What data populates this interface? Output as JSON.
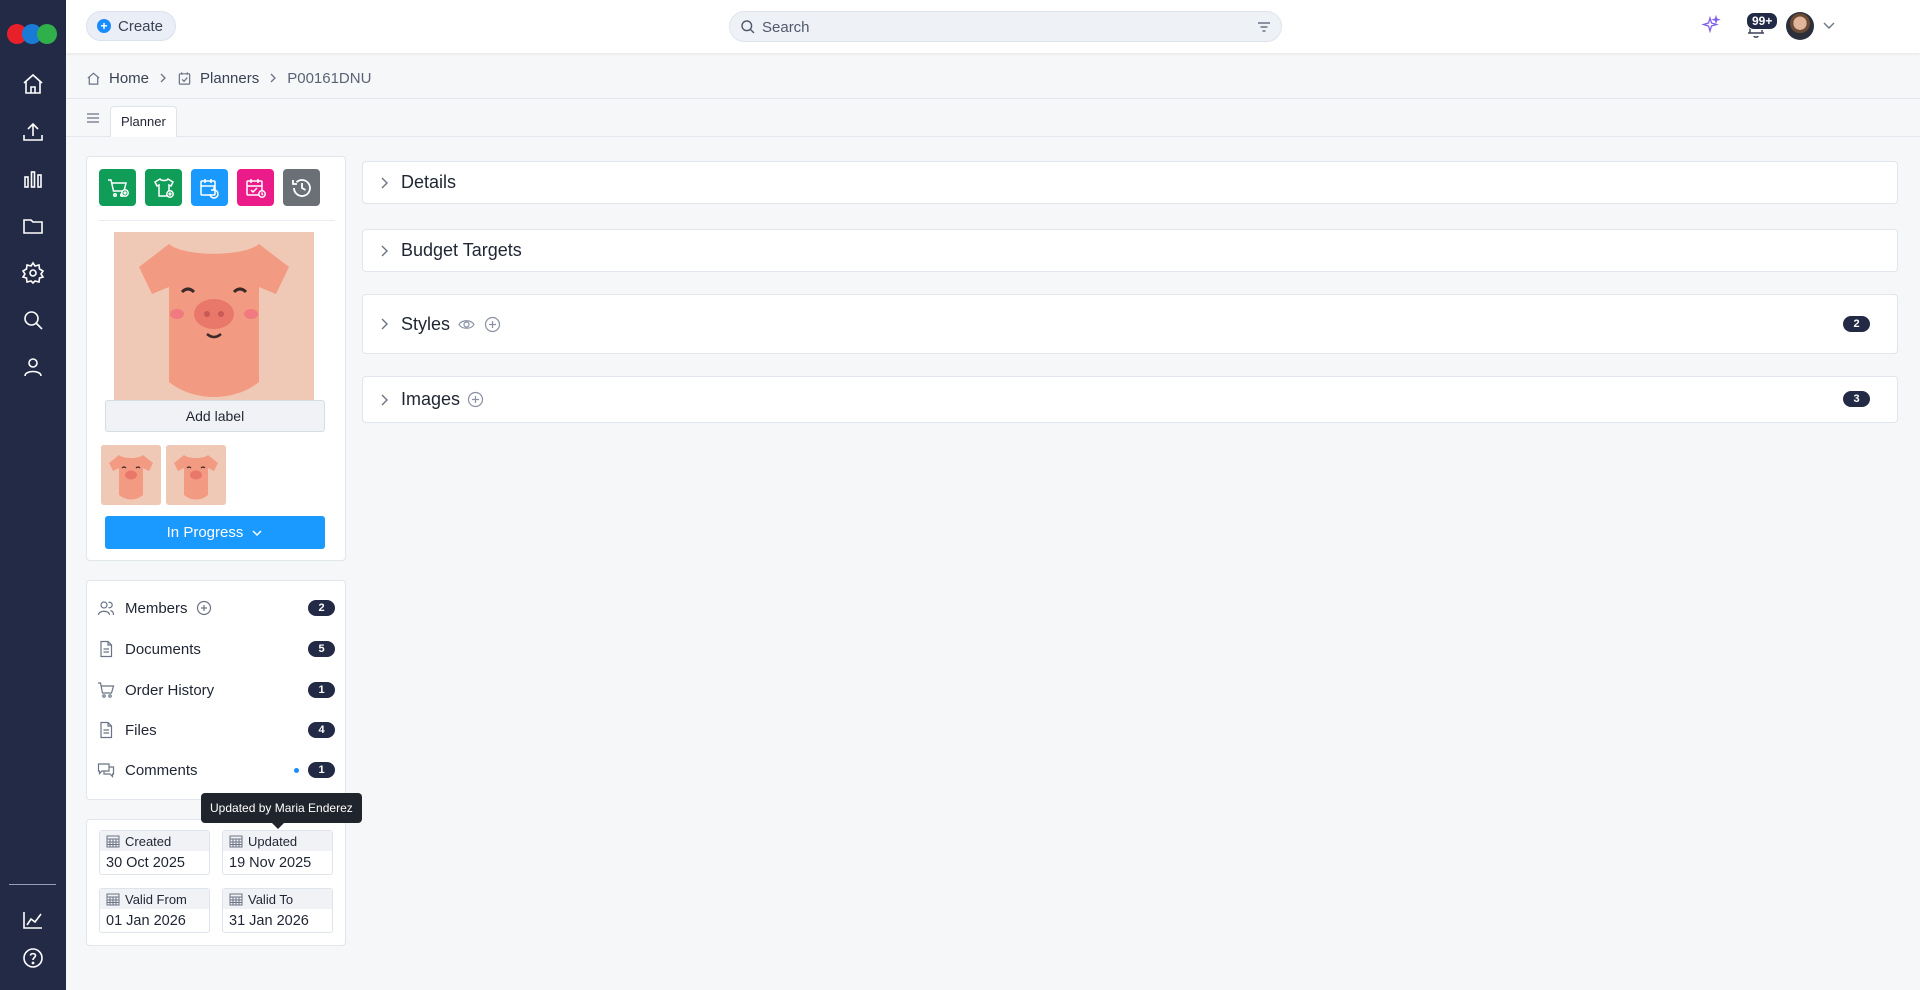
{
  "topbar": {
    "create_label": "Create",
    "search_placeholder": "Search",
    "notifications_badge": "99+"
  },
  "breadcrumb": {
    "home": "Home",
    "planners": "Planners",
    "current": "P00161DNU"
  },
  "tabs": {
    "planner": "Planner"
  },
  "left_panel": {
    "add_label": "Add label",
    "status": "In Progress",
    "action_colors": [
      "#0f9d58",
      "#0f9d58",
      "#1a99ff",
      "#ec1b8a",
      "#6b6f76"
    ],
    "nav": [
      {
        "label": "Members",
        "count": "2"
      },
      {
        "label": "Documents",
        "count": "5"
      },
      {
        "label": "Order History",
        "count": "1"
      },
      {
        "label": "Files",
        "count": "4"
      },
      {
        "label": "Comments",
        "count": "1"
      }
    ],
    "dates": {
      "created_label": "Created",
      "created_value": "30 Oct 2025",
      "updated_label": "Updated",
      "updated_value": "19 Nov 2025",
      "valid_from_label": "Valid From",
      "valid_from_value": "01 Jan 2026",
      "valid_to_label": "Valid To",
      "valid_to_value": "31 Jan 2026"
    },
    "tooltip": "Updated by Maria Enderez"
  },
  "sections": [
    {
      "title": "Details"
    },
    {
      "title": "Budget Targets"
    },
    {
      "title": "Styles",
      "count": "2"
    },
    {
      "title": "Images",
      "count": "3"
    }
  ],
  "colors": {
    "rail": "#232a45",
    "accent": "#1a99ff",
    "badge": "#232a45"
  }
}
